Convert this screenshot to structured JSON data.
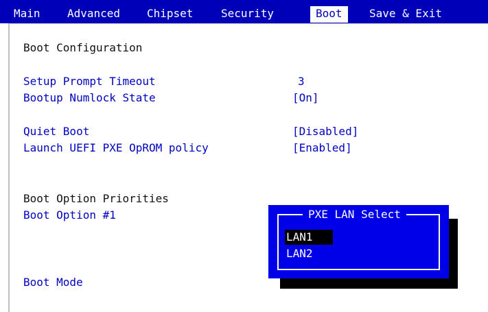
{
  "tabs": [
    {
      "label": "Main"
    },
    {
      "label": "Advanced"
    },
    {
      "label": "Chipset"
    },
    {
      "label": "Security"
    },
    {
      "label": "Boot",
      "active": true
    },
    {
      "label": "Save & Exit"
    }
  ],
  "section_title": "Boot Configuration",
  "settings": [
    {
      "label": "Setup Prompt Timeout",
      "value": "3"
    },
    {
      "label": "Bootup Numlock State",
      "value": "[On]"
    },
    {
      "label": "Quiet Boot",
      "value": "[Disabled]"
    },
    {
      "label": "Launch UEFI PXE OpROM policy",
      "value": "[Enabled]"
    },
    {
      "label": "PXE LAN Select",
      "value": "[LAN1]"
    }
  ],
  "priorities_title": "Boot Option Priorities",
  "boot_option_1": "Boot Option #1",
  "boot_mode": "Boot Mode",
  "popup": {
    "title": "PXE LAN Select",
    "options": [
      "LAN1",
      "LAN2"
    ],
    "selected": "LAN1"
  },
  "colors": {
    "bios_blue": "#0000b8",
    "popup_blue": "#0000e8",
    "text_blue": "#0000c0"
  }
}
